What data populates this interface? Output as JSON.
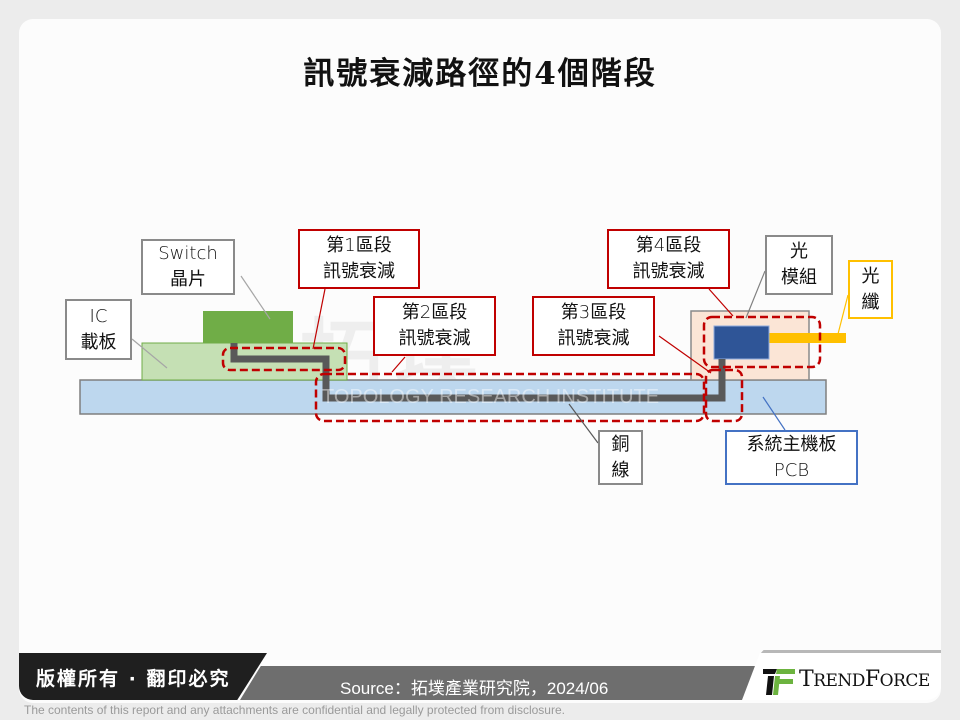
{
  "title": "訊號衰減路徑的4個階段",
  "diagram": {
    "labels": {
      "ic_substrate": [
        "IC",
        "載板"
      ],
      "switch_chip": [
        "Switch",
        "晶片"
      ],
      "stage1": [
        "第1區段",
        "訊號衰減"
      ],
      "stage2": [
        "第2區段",
        "訊號衰減"
      ],
      "stage3": [
        "第3區段",
        "訊號衰減"
      ],
      "stage4": [
        "第4區段",
        "訊號衰減"
      ],
      "optical_module": [
        "光",
        "模組"
      ],
      "optical_fiber": [
        "光",
        "纖"
      ],
      "copper_line": [
        "銅",
        "線"
      ],
      "system_pcb": [
        "系統主機板",
        "PCB"
      ]
    },
    "colors": {
      "pcb": "#bdd7ee",
      "ic_substrate": "#c5e0b4",
      "switch_chip": "#70ad47",
      "optical_base": "#fbe5d6",
      "optical_chip": "#2f5597",
      "fiber": "#ffc000",
      "copper": "#595959",
      "stage_dash": "#c00000"
    },
    "watermark": {
      "cn": "拓墣",
      "en": "TOPOLOGY RESEARCH INSTITUTE"
    }
  },
  "footer": {
    "copyright": "版權所有 · 翻印必究",
    "source": "Source：拓墣產業研究院，2024/06",
    "brand": "TrendForce",
    "brand_display": {
      "t": "T",
      "rend": "REND",
      "f": "F",
      "orce": "ORCE"
    },
    "disclaimer": "The contents of this report and any attachments are confidential and legally protected from disclosure."
  }
}
